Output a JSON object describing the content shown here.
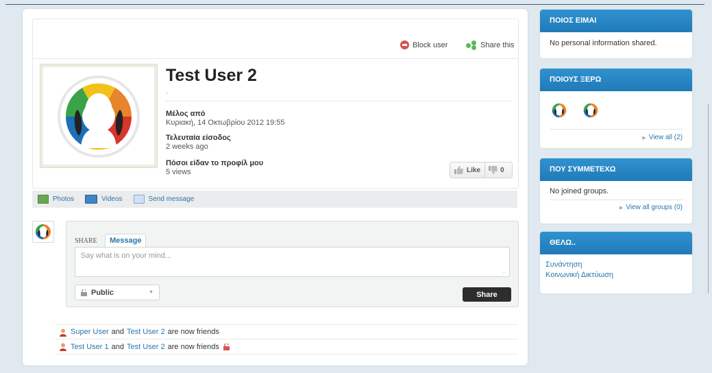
{
  "actions": {
    "block": "Block user",
    "share": "Share this"
  },
  "profile": {
    "name": "Test User 2",
    "status": "-",
    "member_label": "Μέλος από",
    "member_value": "Κυριακή, 14 Οκτωβρίου 2012 19:55",
    "lastlogin_label": "Τελευταία είσοδος",
    "lastlogin_value": "2 weeks ago",
    "views_label": "Πόσοι είδαν το προφίλ μου",
    "views_value": "5 views",
    "like_label": "Like",
    "dislike_count": "0"
  },
  "tabs": {
    "photos": "Photos",
    "videos": "Videos",
    "message": "Send message"
  },
  "share": {
    "label": "SHARE",
    "tab": "Message",
    "placeholder": "Say what is on your mind...",
    "privacy": "Public",
    "button": "Share"
  },
  "activities": [
    {
      "user1": "Super User",
      "conj": "and",
      "user2": "Test User 2",
      "text": "are now friends"
    },
    {
      "user1": "Test User 1",
      "conj": "and",
      "user2": "Test User 2",
      "text": "are now friends"
    }
  ],
  "sidebar": {
    "about": {
      "title": "ΠΟΙΟΣ ΕΙΜΑΙ",
      "text": "No personal information shared."
    },
    "friends": {
      "title": "ΠΟΙΟΥΣ ΞΕΡΩ",
      "view_all": "View all (2)"
    },
    "groups": {
      "title": "ΠΟΥ ΣΥΜΜΕΤΕΧΩ",
      "text": "No joined groups.",
      "view_all": "View all groups (0)"
    },
    "wants": {
      "title": "ΘΕΛΩ..",
      "items": [
        "Συνάντηση",
        "Κοινωνική Δικτύωση"
      ]
    }
  },
  "colors": {
    "accent": "#2b75a8",
    "header": "#2287c8",
    "avatar_ring": [
      "#e8842c",
      "#3aa349",
      "#1d6fb8",
      "#d9352a",
      "#f2c21a"
    ]
  }
}
